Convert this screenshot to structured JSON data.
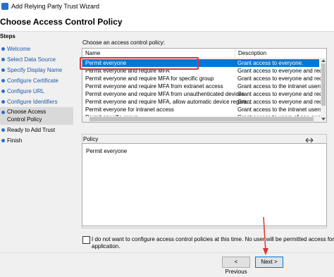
{
  "window": {
    "title": "Add Relying Party Trust Wizard"
  },
  "page": {
    "title": "Choose Access Control Policy"
  },
  "steps": {
    "label": "Steps",
    "items": [
      {
        "label": "Welcome"
      },
      {
        "label": "Select Data Source"
      },
      {
        "label": "Specify Display Name"
      },
      {
        "label": "Configure Certificate"
      },
      {
        "label": "Configure URL"
      },
      {
        "label": "Configure Identifiers"
      },
      {
        "label": "Choose Access Control Policy"
      },
      {
        "label": "Ready to Add Trust"
      },
      {
        "label": "Finish"
      }
    ]
  },
  "policy_list": {
    "prompt": "Choose an access control policy:",
    "columns": {
      "name": "Name",
      "description": "Description"
    },
    "rows": [
      {
        "name": "Permit everyone",
        "description": "Grant access to everyone."
      },
      {
        "name": "Permit everyone and require MFA",
        "description": "Grant access to everyone and requi"
      },
      {
        "name": "Permit everyone and require MFA for specific group",
        "description": "Grant access to everyone and requi"
      },
      {
        "name": "Permit everyone and require MFA from extranet access",
        "description": "Grant access to the intranet users an"
      },
      {
        "name": "Permit everyone and require MFA from unauthenticated devices",
        "description": "Grant access to everyone and requi"
      },
      {
        "name": "Permit everyone and require MFA, allow automatic device registr...",
        "description": "Grant access to everyone and requi"
      },
      {
        "name": "Permit everyone for intranet access",
        "description": "Grant access to the intranet users."
      },
      {
        "name": "Permit specific group",
        "description": "Grant access to users of one or mor"
      }
    ],
    "selected_index": 0
  },
  "policy": {
    "label": "Policy",
    "text": "Permit everyone"
  },
  "checkbox": {
    "line1": "I do not want to configure access control policies at this time. No user will be permitted access for this",
    "line2": "application.",
    "checked": false
  },
  "buttons": {
    "previous": "< Previous",
    "next": "Next >"
  },
  "colors": {
    "selection": "#0078d7",
    "annotation": "#e2332f",
    "link": "#1c5aa6"
  }
}
